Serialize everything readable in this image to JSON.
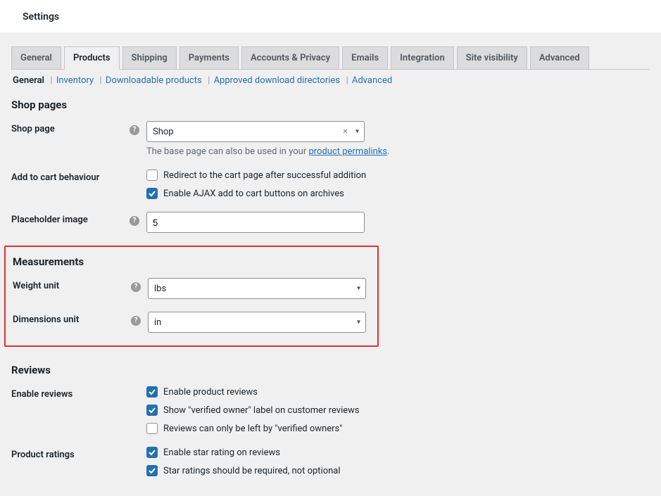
{
  "page_title": "Settings",
  "tabs": [
    "General",
    "Products",
    "Shipping",
    "Payments",
    "Accounts & Privacy",
    "Emails",
    "Integration",
    "Site visibility",
    "Advanced"
  ],
  "active_tab": 1,
  "subtabs": [
    "General",
    "Inventory",
    "Downloadable products",
    "Approved download directories",
    "Advanced"
  ],
  "active_subtab": 0,
  "sections": {
    "shop_pages": {
      "title": "Shop pages",
      "shop_page": {
        "label": "Shop page",
        "value": "Shop"
      },
      "helper_pre": "The base page can also be used in your ",
      "helper_link": "product permalinks",
      "helper_post": ".",
      "add_to_cart": {
        "label": "Add to cart behaviour",
        "opt_redirect": "Redirect to the cart page after successful addition",
        "opt_ajax": "Enable AJAX add to cart buttons on archives",
        "redirect_checked": false,
        "ajax_checked": true
      },
      "placeholder": {
        "label": "Placeholder image",
        "value": "5"
      }
    },
    "measurements": {
      "title": "Measurements",
      "weight": {
        "label": "Weight unit",
        "value": "lbs"
      },
      "dimensions": {
        "label": "Dimensions unit",
        "value": "in"
      }
    },
    "reviews": {
      "title": "Reviews",
      "enable_reviews": {
        "label": "Enable reviews",
        "opt_enable": "Enable product reviews",
        "opt_show_verified": "Show \"verified owner\" label on customer reviews",
        "opt_only_verified": "Reviews can only be left by \"verified owners\"",
        "enable_checked": true,
        "show_verified_checked": true,
        "only_verified_checked": false
      },
      "ratings": {
        "label": "Product ratings",
        "opt_star": "Enable star rating on reviews",
        "opt_required": "Star ratings should be required, not optional",
        "star_checked": true,
        "required_checked": true
      }
    }
  }
}
